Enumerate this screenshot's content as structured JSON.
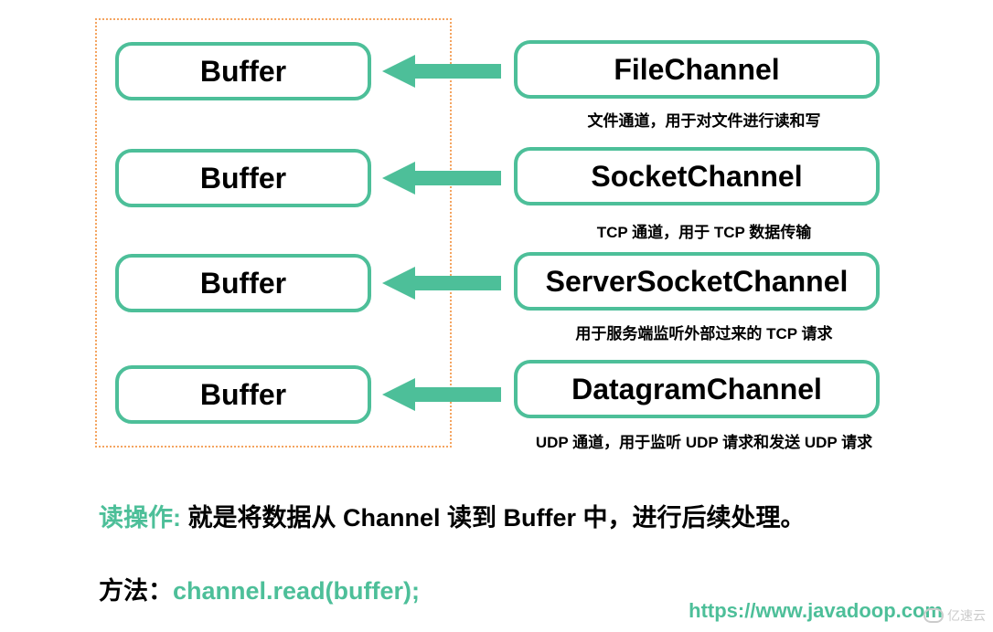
{
  "buffers": [
    "Buffer",
    "Buffer",
    "Buffer",
    "Buffer"
  ],
  "channels": [
    {
      "name": "FileChannel",
      "desc": "文件通道，用于对文件进行读和写"
    },
    {
      "name": "SocketChannel",
      "desc": "TCP 通道，用于 TCP 数据传输"
    },
    {
      "name": "ServerSocketChannel",
      "desc": "用于服务端监听外部过来的 TCP 请求"
    },
    {
      "name": "DatagramChannel",
      "desc": "UDP 通道，用于监听 UDP 请求和发送 UDP 请求"
    }
  ],
  "read_op": {
    "label": "读操作:",
    "text": " 就是将数据从 Channel 读到 Buffer 中，进行后续处理。"
  },
  "method": {
    "label": "方法：",
    "code": "channel.read(buffer);"
  },
  "url": "https://www.javadoop.com",
  "watermark": "亿速云",
  "colors": {
    "accent": "#4dbf99",
    "dash": "#f4a460"
  }
}
